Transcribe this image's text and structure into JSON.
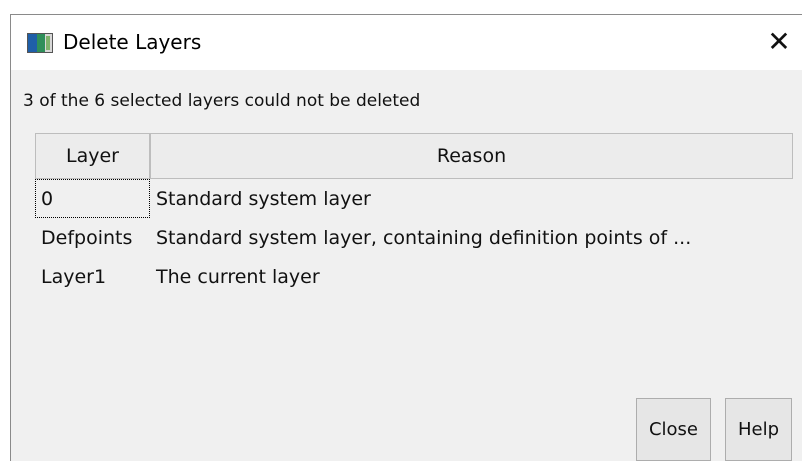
{
  "window": {
    "title": "Delete Layers",
    "close_glyph": "✕",
    "icon": "layers-app-icon"
  },
  "message": "3 of the 6 selected layers could not be deleted",
  "table": {
    "headers": {
      "layer": "Layer",
      "reason": "Reason"
    },
    "rows": [
      {
        "layer": "0",
        "reason": "Standard system layer"
      },
      {
        "layer": "Defpoints",
        "reason": "Standard system layer, containing definition points of ..."
      },
      {
        "layer": "Layer1",
        "reason": "The current layer"
      }
    ]
  },
  "buttons": {
    "close": "Close",
    "help": "Help"
  }
}
